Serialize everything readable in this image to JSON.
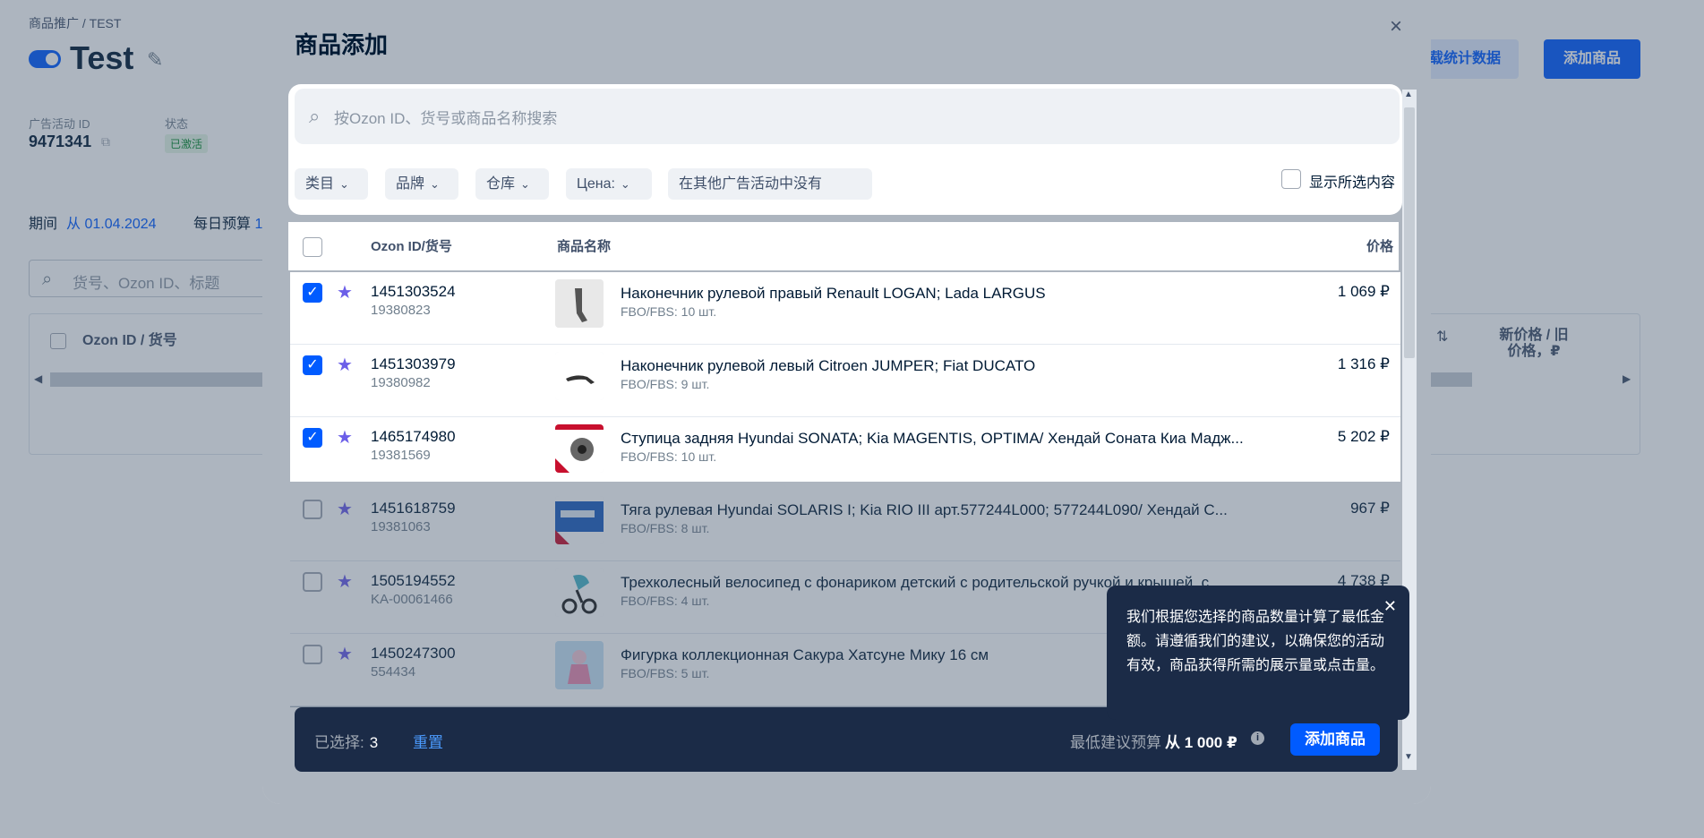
{
  "background": {
    "breadcrumb": "商品推广 / TEST",
    "title": "Test",
    "stats_button": "下载统计数据",
    "add_button": "添加商品",
    "campaign_id_label": "广告活动 ID",
    "campaign_id": "9471341",
    "status_label": "状态",
    "status_badge": "已激活",
    "period_label": "期间",
    "period_value": "从 01.04.2024",
    "budget_label": "每日预算",
    "budget_value": "1",
    "search_placeholder": "货号、Ozon ID、标题",
    "table_header_id": "Ozon ID / 货号",
    "table_header_price": "新价格 / 旧价格，₽",
    "sort_icon": "⇅"
  },
  "modal": {
    "title": "商品添加",
    "close": "×",
    "search_placeholder": "按Ozon ID、货号或商品名称搜索",
    "filters": [
      "类目",
      "品牌",
      "仓库",
      "Цена:"
    ],
    "filter_other": "在其他广告活动中没有",
    "show_selected": "显示所选内容",
    "headers": {
      "id": "Ozon ID/货号",
      "name": "商品名称",
      "price": "价格"
    },
    "rows": [
      {
        "id": "1451303524",
        "sku": "19380823",
        "name": "Наконечник рулевой правый Renault LOGAN; Lada LARGUS",
        "stock": "FBO/FBS: 10 шт.",
        "price": "1 069 ₽",
        "checked": true
      },
      {
        "id": "1451303979",
        "sku": "19380982",
        "name": "Наконечник рулевой левый Citroen JUMPER; Fiat DUCATO",
        "stock": "FBO/FBS: 9 шт.",
        "price": "1 316 ₽",
        "checked": true
      },
      {
        "id": "1465174980",
        "sku": "19381569",
        "name": "Ступица задняя Hyundai SONATA; Kia MAGENTIS, OPTIMA/ Хендай Соната Киа Мадж...",
        "stock": "FBO/FBS: 10 шт.",
        "price": "5 202 ₽",
        "checked": true
      },
      {
        "id": "1451618759",
        "sku": "19381063",
        "name": "Тяга рулевая Hyundai SOLARIS I; Kia RIO III арт.577244L000; 577244L090/ Хендай С...",
        "stock": "FBO/FBS: 8 шт.",
        "price": "967 ₽",
        "checked": false
      },
      {
        "id": "1505194552",
        "sku": "KA-00061466",
        "name": "Трехколесный велосипед с фонариком детский с родительской ручкой и крышей, с...",
        "stock": "FBO/FBS: 4 шт.",
        "price": "4 738 ₽",
        "checked": false
      },
      {
        "id": "1450247300",
        "sku": "554434",
        "name": "Фигурка коллекционная Сакура Хатсуне Мику 16 см",
        "stock": "FBO/FBS: 5 шт.",
        "price": "",
        "checked": false
      }
    ],
    "tooltip": "我们根据您选择的商品数量计算了最低金额。请遵循我们的建议，以确保您的活动有效，商品获得所需的展示量或点击量。",
    "footer": {
      "selected_label": "已选择:",
      "selected_count": "3",
      "reset": "重置",
      "min_budget_label": "最低建议预算",
      "min_budget_value": "从 1 000 ₽",
      "info_icon": "i",
      "add_button": "添加商品"
    }
  },
  "colors": {
    "accent": "#005bff",
    "dark": "#1b2b47",
    "star": "#6b5ee8"
  }
}
